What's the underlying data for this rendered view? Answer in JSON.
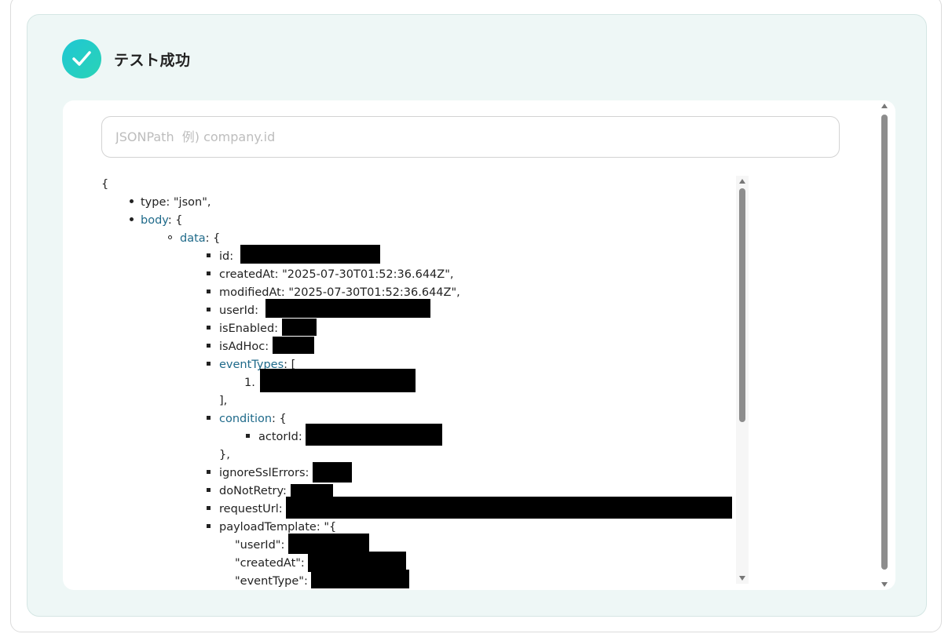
{
  "header": {
    "title": "テスト成功",
    "status_icon": "check-circle-icon",
    "accent": "#20c9c6"
  },
  "search": {
    "placeholder": "JSONPath  例) company.id",
    "value": ""
  },
  "json_view": {
    "open_brace": "{",
    "type_line": "type: \"json\",",
    "body_key": "body",
    "body_suffix": ": {",
    "data_key": "data",
    "data_suffix": ": {",
    "id_label": "id:",
    "createdAt_line": "createdAt: \"2025-07-30T01:52:36.644Z\",",
    "modifiedAt_line": "modifiedAt: \"2025-07-30T01:52:36.644Z\",",
    "userId_label": "userId:",
    "isEnabled_label": "isEnabled:",
    "isAdHoc_label": "isAdHoc:",
    "eventTypes_key": "eventTypes",
    "eventTypes_suffix": ": [",
    "event_item_num": "1.",
    "array_close": "],",
    "condition_key": "condition",
    "condition_suffix": ": {",
    "actorId_label": "actorId:",
    "obj_close": "},",
    "ignoreSslErrors_label": "ignoreSslErrors:",
    "doNotRetry_label": "doNotRetry:",
    "requestUrl_label": "requestUrl:",
    "payloadTemplate_line": "payloadTemplate: \"{",
    "pt_userId": "\"userId\":",
    "pt_createdAt": "\"createdAt\":",
    "pt_eventType": "\"eventType\":"
  }
}
